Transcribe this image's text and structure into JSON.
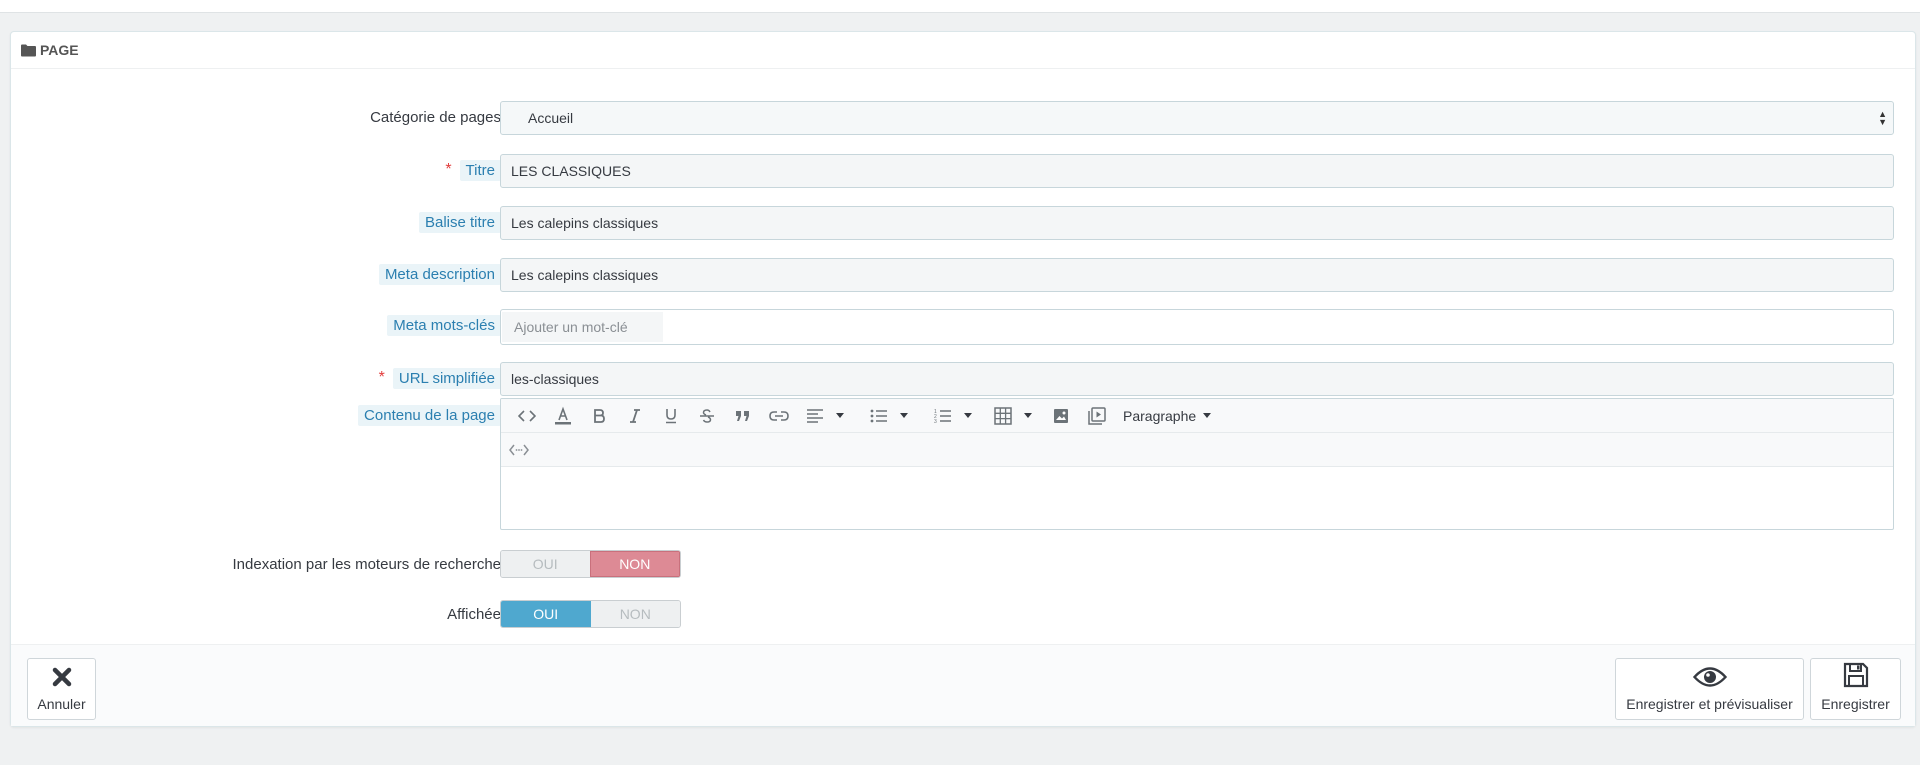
{
  "panel": {
    "title": "PAGE"
  },
  "fields": {
    "category": {
      "label": "Catégorie de pages",
      "value": "Accueil"
    },
    "title": {
      "label": "Titre",
      "required_mark": "*",
      "value": "LES CLASSIQUES"
    },
    "meta_title": {
      "label": "Balise titre",
      "value": "Les calepins classiques"
    },
    "meta_description": {
      "label": "Meta description",
      "value": "Les calepins classiques"
    },
    "meta_keywords": {
      "label": "Meta mots-clés",
      "placeholder": "Ajouter un mot-clé"
    },
    "friendly_url": {
      "label": "URL simplifiée",
      "required_mark": "*",
      "value": "les-classiques"
    },
    "content": {
      "label": "Contenu de la page",
      "format_label": "Paragraphe"
    },
    "indexation": {
      "label": "Indexation par les moteurs de recherche",
      "yes": "OUI",
      "no": "NON",
      "selected": "NON"
    },
    "displayed": {
      "label": "Affichée",
      "yes": "OUI",
      "no": "NON",
      "selected": "OUI"
    }
  },
  "footer": {
    "cancel": "Annuler",
    "save_preview": "Enregistrer et prévisualiser",
    "save": "Enregistrer"
  },
  "colors": {
    "accent_blue": "#4fa8cf",
    "no_active": "#dd8a95",
    "required": "#e23b3b",
    "hint_label": "#2b7fb0"
  }
}
